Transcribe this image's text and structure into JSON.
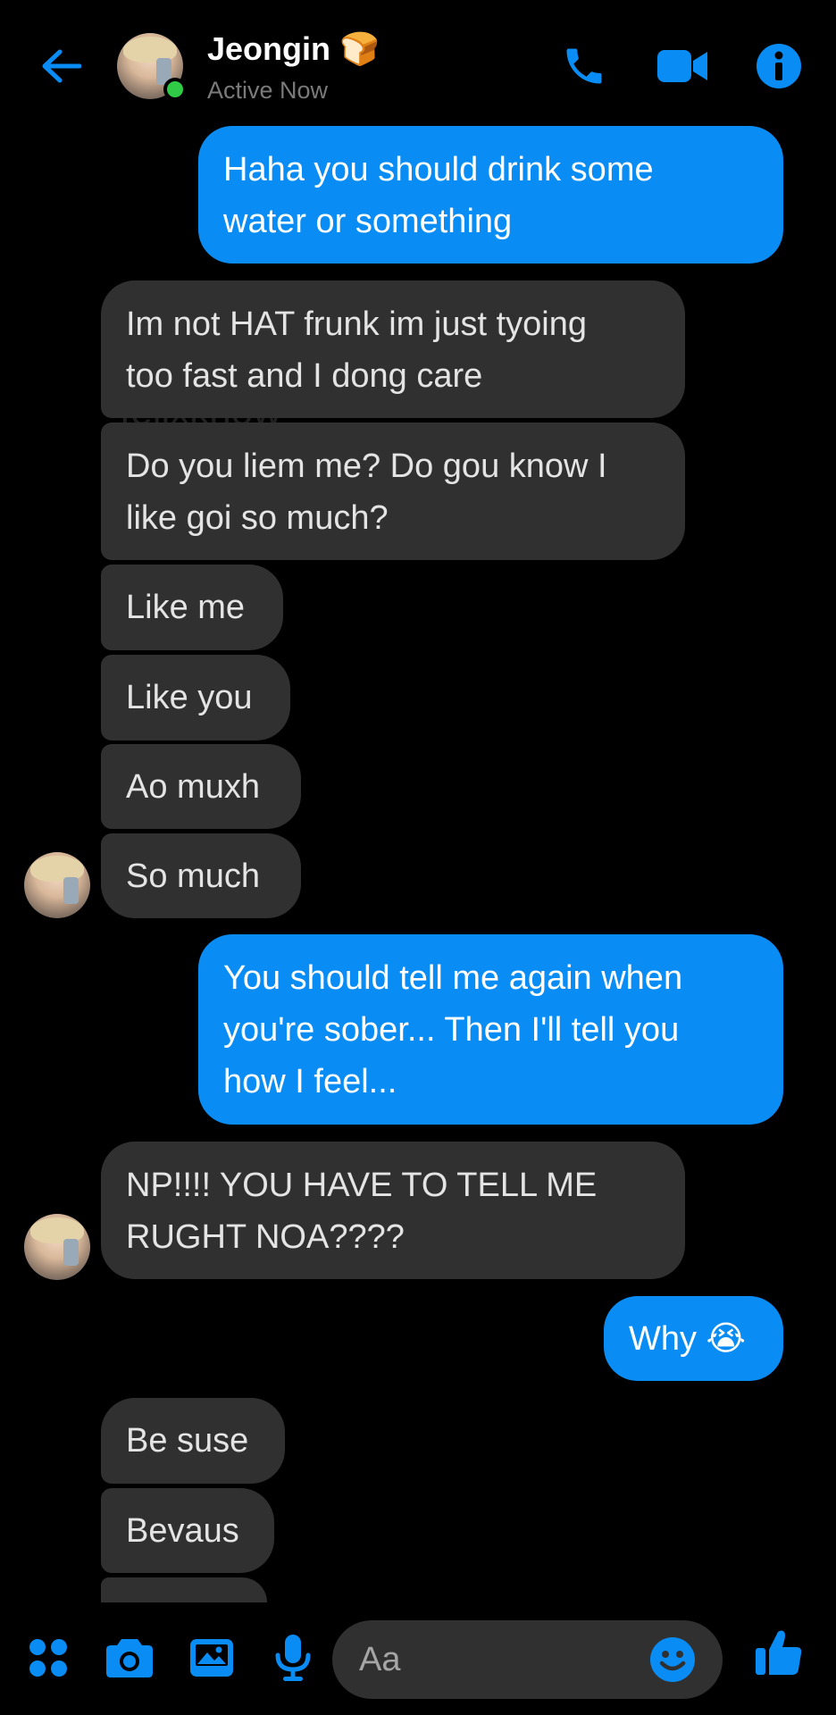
{
  "colors": {
    "accent": "#0a8cf5",
    "incoming_bubble": "#303030",
    "background": "#000000",
    "online": "#31cc46"
  },
  "header": {
    "contact_name": "Jeongin 🍞",
    "status": "Active Now",
    "icons": [
      "back-arrow-icon",
      "phone-icon",
      "video-camera-icon",
      "info-icon"
    ]
  },
  "watermark": "felixknow",
  "messages": [
    {
      "side": "out",
      "lines": [
        "Haha you should drink some",
        "water or something"
      ]
    },
    {
      "side": "in",
      "lines": [
        "Im not HAT frunk im just tyoing",
        "too fast and I dong care"
      ]
    },
    {
      "side": "in",
      "lines": [
        "Do you liem me? Do gou know I",
        "like goi so much?"
      ]
    },
    {
      "side": "in",
      "lines": [
        "Like me"
      ]
    },
    {
      "side": "in",
      "lines": [
        "Like you"
      ]
    },
    {
      "side": "in",
      "lines": [
        "Ao muxh"
      ]
    },
    {
      "side": "in",
      "lines": [
        "So much"
      ]
    },
    {
      "side": "out",
      "lines": [
        "You should tell me again when",
        "you're sober... Then I'll tell you",
        "how I feel..."
      ]
    },
    {
      "side": "in",
      "lines": [
        "NP!!!! YOU HAVE TO TELL ME",
        "RUGHT NOA????"
      ]
    },
    {
      "side": "out",
      "lines": [
        "Why 😭"
      ]
    },
    {
      "side": "in",
      "lines": [
        "Be suse"
      ]
    },
    {
      "side": "in",
      "lines": [
        "Bevaus"
      ]
    }
  ],
  "composer": {
    "placeholder": "Aa",
    "icons": [
      "apps-grid-icon",
      "camera-icon",
      "gallery-icon",
      "microphone-icon",
      "emoji-icon",
      "thumbs-up-icon"
    ]
  }
}
